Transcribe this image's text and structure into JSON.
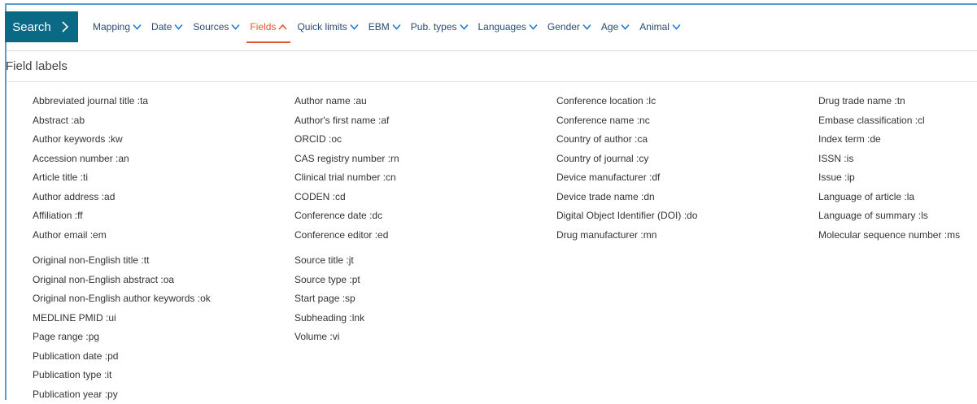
{
  "search_button": {
    "label": "Search"
  },
  "tabs": [
    {
      "label": "Mapping",
      "active": false
    },
    {
      "label": "Date",
      "active": false
    },
    {
      "label": "Sources",
      "active": false
    },
    {
      "label": "Fields",
      "active": true
    },
    {
      "label": "Quick limits",
      "active": false
    },
    {
      "label": "EBM",
      "active": false
    },
    {
      "label": "Pub. types",
      "active": false
    },
    {
      "label": "Languages",
      "active": false
    },
    {
      "label": "Gender",
      "active": false
    },
    {
      "label": "Age",
      "active": false
    },
    {
      "label": "Animal",
      "active": false
    }
  ],
  "section_title": "Field labels",
  "columns": [
    {
      "group1": [
        "Abbreviated journal title :ta",
        "Abstract :ab",
        "Author keywords :kw",
        "Accession number :an",
        "Article title :ti",
        "Author address :ad",
        "Affiliation :ff",
        "Author email :em"
      ],
      "group2": [
        "Original non-English title :tt",
        "Original non-English abstract :oa",
        "Original non-English author keywords :ok",
        "MEDLINE PMID :ui",
        "Page range :pg",
        "Publication date :pd",
        "Publication type :it",
        "Publication year :py"
      ]
    },
    {
      "group1": [
        "Author name :au",
        "Author's first name :af",
        "ORCID :oc",
        "CAS registry number :rn",
        "Clinical trial number :cn",
        "CODEN :cd",
        "Conference date :dc",
        "Conference editor :ed"
      ],
      "group2": [
        "Source title :jt",
        "Source type :pt",
        "Start page :sp",
        "Subheading :lnk",
        "Volume :vi"
      ]
    },
    {
      "group1": [
        "Conference location :lc",
        "Conference name :nc",
        "Country of author :ca",
        "Country of journal :cy",
        "Device manufacturer :df",
        "Device trade name :dn",
        "Digital Object Identifier (DOI) :do",
        "Drug manufacturer :mn"
      ],
      "group2": []
    },
    {
      "group1": [
        "Drug trade name :tn",
        "Embase classification :cl",
        "Index term :de",
        "ISSN :is",
        "Issue :ip",
        "Language of article :la",
        "Language of summary :ls",
        "Molecular sequence number :ms"
      ],
      "group2": []
    }
  ],
  "colors": {
    "search_bg": "#0a6985",
    "tab_text": "#2a4a73",
    "active_tab": "#e4572e",
    "caret": "#1f7bd0",
    "frame_border": "#5b9bd5"
  },
  "icons": {
    "search_chevron": "chevron-right-icon",
    "tab_caret": "chevron-down-icon",
    "active_caret": "chevron-up-icon"
  }
}
